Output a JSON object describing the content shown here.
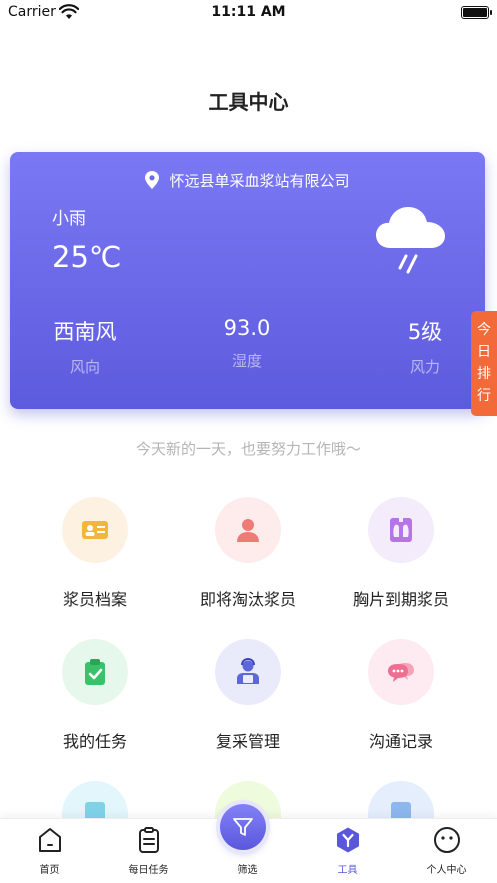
{
  "status_bar": {
    "carrier": "Carrier",
    "time": "11:11 AM",
    "battery_level": 1.0
  },
  "page": {
    "title": "工具中心"
  },
  "weather": {
    "location": "怀远县单采血浆站有限公司",
    "condition": "小雨",
    "temperature": "25℃",
    "icon": "cloud-rain-icon",
    "wind_direction": {
      "value": "西南风",
      "label": "风向"
    },
    "humidity": {
      "value": "93.0",
      "label": "湿度"
    },
    "wind_force": {
      "value": "5级",
      "label": "风力"
    }
  },
  "rank_tab": {
    "label": "今日排行"
  },
  "motto": "今天新的一天，也要努力工作哦～",
  "tools": [
    {
      "label": "浆员档案",
      "icon": "id-card-icon",
      "bg": "#fdf1e1",
      "color": "#f4b53c"
    },
    {
      "label": "即将淘汰浆员",
      "icon": "person-icon",
      "bg": "#fdeceb",
      "color": "#ef7b76"
    },
    {
      "label": "胸片到期浆员",
      "icon": "xray-icon",
      "bg": "#f4ebfb",
      "color": "#b574e7"
    },
    {
      "label": "我的任务",
      "icon": "clipboard-check-icon",
      "bg": "#e6f8ec",
      "color": "#39c26a"
    },
    {
      "label": "复采管理",
      "icon": "operator-icon",
      "bg": "#e9ebfb",
      "color": "#5d67d9"
    },
    {
      "label": "沟通记录",
      "icon": "chat-bubbles-icon",
      "bg": "#fdebf1",
      "color": "#ee6f91"
    }
  ],
  "tab_bar": {
    "tabs": [
      {
        "label": "首页",
        "icon": "home-icon"
      },
      {
        "label": "每日任务",
        "icon": "task-list-icon"
      },
      {
        "label": "筛选",
        "icon": "filter-icon"
      },
      {
        "label": "工具",
        "icon": "tools-icon",
        "active": true
      },
      {
        "label": "个人中心",
        "icon": "profile-face-icon"
      }
    ],
    "active_color": "#5a57dc"
  }
}
